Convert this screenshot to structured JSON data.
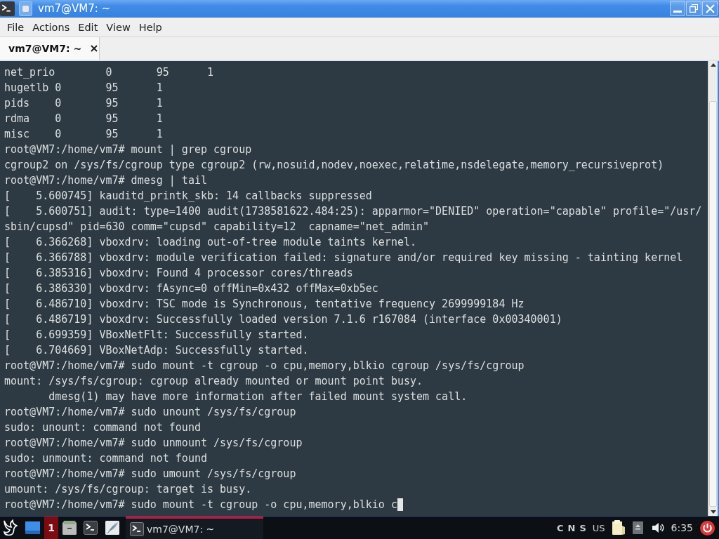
{
  "window": {
    "title": "vm7@VM7: ~"
  },
  "menu": [
    {
      "label": "File"
    },
    {
      "label": "Actions"
    },
    {
      "label": "Edit"
    },
    {
      "label": "View"
    },
    {
      "label": "Help"
    }
  ],
  "tabs": [
    {
      "label": "vm7@VM7: ~",
      "selected": true
    }
  ],
  "terminal": {
    "lines": [
      "net_prio        0       95      1",
      "hugetlb 0       95      1",
      "pids    0       95      1",
      "rdma    0       95      1",
      "misc    0       95      1",
      "root@VM7:/home/vm7# mount | grep cgroup",
      "cgroup2 on /sys/fs/cgroup type cgroup2 (rw,nosuid,nodev,noexec,relatime,nsdelegate,memory_recursiveprot)",
      "root@VM7:/home/vm7# dmesg | tail",
      "[    5.600745] kauditd_printk_skb: 14 callbacks suppressed",
      "[    5.600751] audit: type=1400 audit(1738581622.484:25): apparmor=\"DENIED\" operation=\"capable\" profile=\"/usr/",
      "sbin/cupsd\" pid=630 comm=\"cupsd\" capability=12  capname=\"net_admin\"",
      "[    6.366268] vboxdrv: loading out-of-tree module taints kernel.",
      "[    6.366788] vboxdrv: module verification failed: signature and/or required key missing - tainting kernel",
      "[    6.385316] vboxdrv: Found 4 processor cores/threads",
      "[    6.386330] vboxdrv: fAsync=0 offMin=0x432 offMax=0xb5ec",
      "[    6.486710] vboxdrv: TSC mode is Synchronous, tentative frequency 2699999184 Hz",
      "[    6.486719] vboxdrv: Successfully loaded version 7.1.6 r167084 (interface 0x00340001)",
      "[    6.699359] VBoxNetFlt: Successfully started.",
      "[    6.704669] VBoxNetAdp: Successfully started.",
      "root@VM7:/home/vm7# sudo mount -t cgroup -o cpu,memory,blkio cgroup /sys/fs/cgroup",
      "mount: /sys/fs/cgroup: cgroup already mounted or mount point busy.",
      "       dmesg(1) may have more information after failed mount system call.",
      "root@VM7:/home/vm7# sudo unount /sys/fs/cgroup",
      "sudo: unount: command not found",
      "root@VM7:/home/vm7# sudo unmount /sys/fs/cgroup",
      "sudo: unmount: command not found",
      "root@VM7:/home/vm7# sudo umount /sys/fs/cgroup",
      "umount: /sys/fs/cgroup: target is busy.",
      "root@VM7:/home/vm7# sudo mount -t cgroup -o cpu,memory,blkio c"
    ],
    "cursor": true
  },
  "taskbar": {
    "workspace": "1",
    "task": {
      "label": "vm7@VM7: ~",
      "selected": true
    },
    "lock_indicators": [
      {
        "label": "C"
      },
      {
        "label": "N"
      },
      {
        "label": "S"
      }
    ],
    "keyboard_layout": "US",
    "clock": "6:35"
  }
}
